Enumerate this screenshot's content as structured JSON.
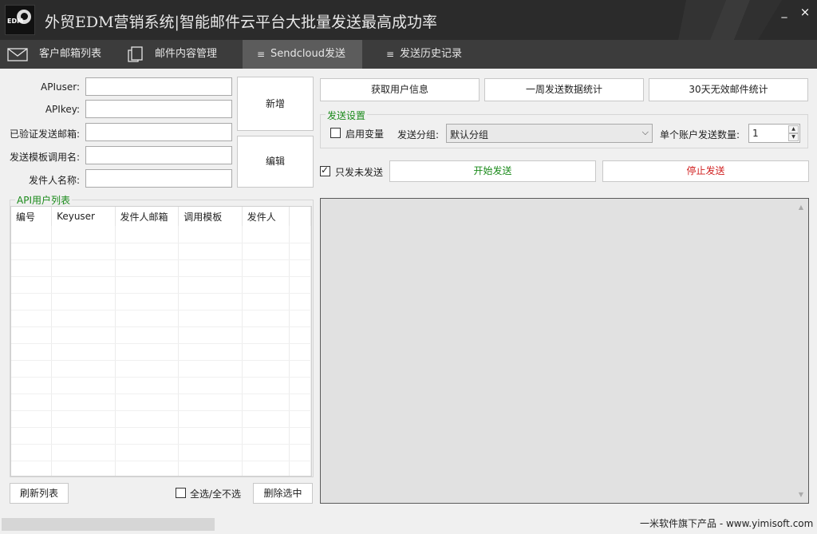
{
  "window": {
    "logo_text": "EDM",
    "title": "外贸EDM营销系统|智能邮件云平台大批量发送最高成功率",
    "minimize": "_",
    "close": "×"
  },
  "tabs": [
    {
      "label": "客户邮箱列表",
      "icon": "mail-icon"
    },
    {
      "label": "邮件内容管理",
      "icon": "document-icon"
    },
    {
      "label": "Sendcloud发送",
      "icon": "list-icon"
    },
    {
      "label": "发送历史记录",
      "icon": "list-icon"
    }
  ],
  "form": {
    "apiuser_label": "APIuser:",
    "apikey_label": "APIkey:",
    "verified_sender_label": "已验证发送邮箱:",
    "template_label": "发送模板调用名:",
    "sender_name_label": "发件人名称:",
    "apiuser_value": "",
    "apikey_value": "",
    "verified_sender_value": "",
    "template_value": "",
    "sender_name_value": "",
    "add_button": "新增",
    "edit_button": "编辑"
  },
  "api_list": {
    "title": "API用户列表",
    "columns": [
      "编号",
      "Keyuser",
      "发件人邮箱",
      "调用模板",
      "发件人"
    ],
    "rows": []
  },
  "bottom_left": {
    "refresh_button": "刷新列表",
    "select_all_label": "全选/全不选",
    "select_all_checked": false,
    "delete_button": "删除选中"
  },
  "actions": {
    "get_user_info": "获取用户信息",
    "weekly_stats": "一周发送数据统计",
    "invalid_stats": "30天无效邮件统计"
  },
  "send_settings": {
    "title": "发送设置",
    "enable_vars_label": "启用变量",
    "enable_vars_checked": false,
    "group_label": "发送分组:",
    "group_value": "默认分组",
    "per_account_label": "单个账户发送数量:",
    "per_account_value": "1"
  },
  "send_controls": {
    "only_unsent_label": "只发未发送",
    "only_unsent_checked": true,
    "start_button": "开始发送",
    "stop_button": "停止发送",
    "start_color": "#1a8a1a",
    "stop_color": "#d02020"
  },
  "log": {
    "content": ""
  },
  "footer": {
    "text": "一米软件旗下产品 - www.yimisoft.com"
  }
}
